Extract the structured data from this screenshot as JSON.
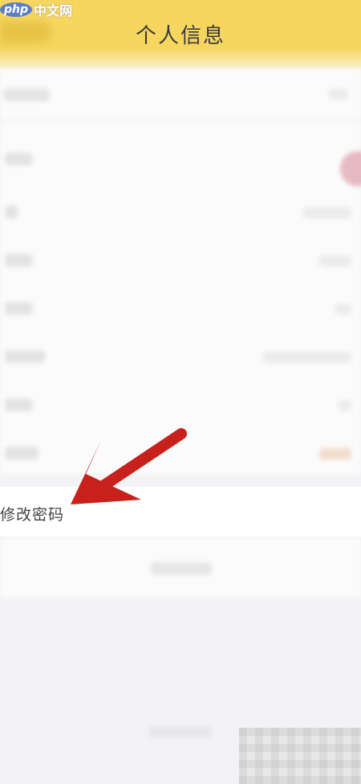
{
  "watermark": {
    "badge": "php",
    "text": "中文网"
  },
  "header": {
    "title": "个人信息"
  },
  "settings": {
    "change_password_label": "修改密码"
  },
  "colors": {
    "header": "#f6d65f",
    "arrow": "#c8201b"
  },
  "icons": {
    "annotation": "red-arrow-icon"
  }
}
